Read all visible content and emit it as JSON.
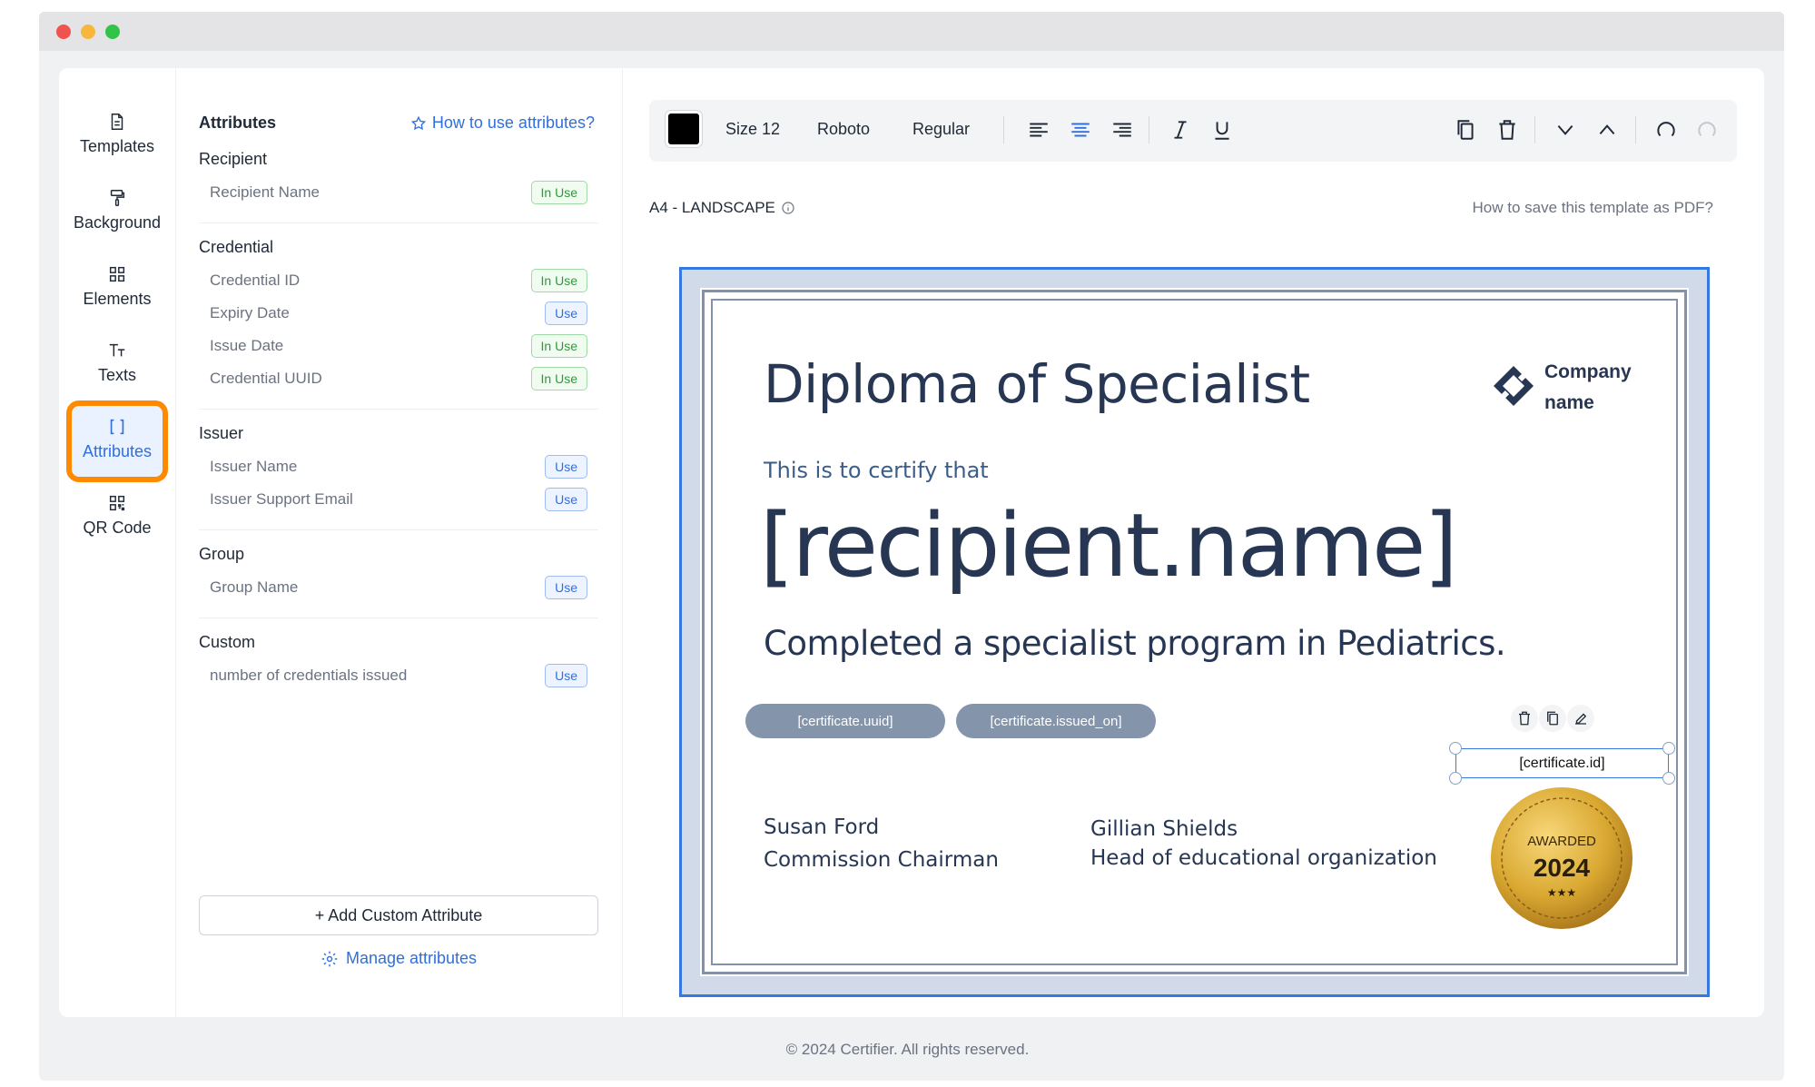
{
  "nav": {
    "items": [
      {
        "label": "Templates",
        "icon": "file-icon"
      },
      {
        "label": "Background",
        "icon": "paint-roller-icon"
      },
      {
        "label": "Elements",
        "icon": "grid-icon"
      },
      {
        "label": "Texts",
        "icon": "text-icon"
      },
      {
        "label": "Attributes",
        "icon": "brackets-icon",
        "active": true
      },
      {
        "label": "QR Code",
        "icon": "qr-code-icon"
      }
    ]
  },
  "panel": {
    "title": "Attributes",
    "howto_link": "How to use attributes?",
    "groups": {
      "recipient": {
        "title": "Recipient",
        "items": [
          {
            "name": "Recipient Name",
            "status": "In Use"
          }
        ]
      },
      "credential": {
        "title": "Credential",
        "items": [
          {
            "name": "Credential ID",
            "status": "In Use"
          },
          {
            "name": "Expiry Date",
            "status": "Use"
          },
          {
            "name": "Issue Date",
            "status": "In Use"
          },
          {
            "name": "Credential UUID",
            "status": "In Use"
          }
        ]
      },
      "issuer": {
        "title": "Issuer",
        "items": [
          {
            "name": "Issuer Name",
            "status": "Use"
          },
          {
            "name": "Issuer Support Email",
            "status": "Use"
          }
        ]
      },
      "group": {
        "title": "Group",
        "items": [
          {
            "name": "Group Name",
            "status": "Use"
          }
        ]
      },
      "custom": {
        "title": "Custom",
        "items": [
          {
            "name": "number of credentials issued",
            "status": "Use"
          }
        ]
      }
    },
    "add_button": "+ Add Custom Attribute",
    "manage_link": "Manage attributes"
  },
  "toolbar": {
    "color": "#000000",
    "size": "Size 12",
    "font": "Roboto",
    "weight": "Regular"
  },
  "canvas": {
    "format": "A4 - LANDSCAPE",
    "save_pdf_link": "How to save this template as PDF?"
  },
  "certificate": {
    "title": "Diploma of Specialist",
    "company_line1": "Company",
    "company_line2": "name",
    "certify_text": "This is to certify that",
    "recipient": "[recipient.name]",
    "completed": "Completed a specialist program in Pediatrics.",
    "uuid_pill": "[certificate.uuid]",
    "issued_pill": "[certificate.issued_on]",
    "id_field": "[certificate.id]",
    "seal_text": "AWARDED",
    "seal_year": "2024",
    "seal_stars": "★★★",
    "sig1_name": "Susan Ford",
    "sig1_title": "Commission Chairman",
    "sig2_name": "Gillian Shields",
    "sig2_title": "Head of educational organization"
  },
  "footer": "© 2024 Certifier. All rights reserved.",
  "colors": {
    "accent": "#2f6fdf",
    "highlight": "#ff8a00",
    "in_use": "#2e9b3a"
  }
}
